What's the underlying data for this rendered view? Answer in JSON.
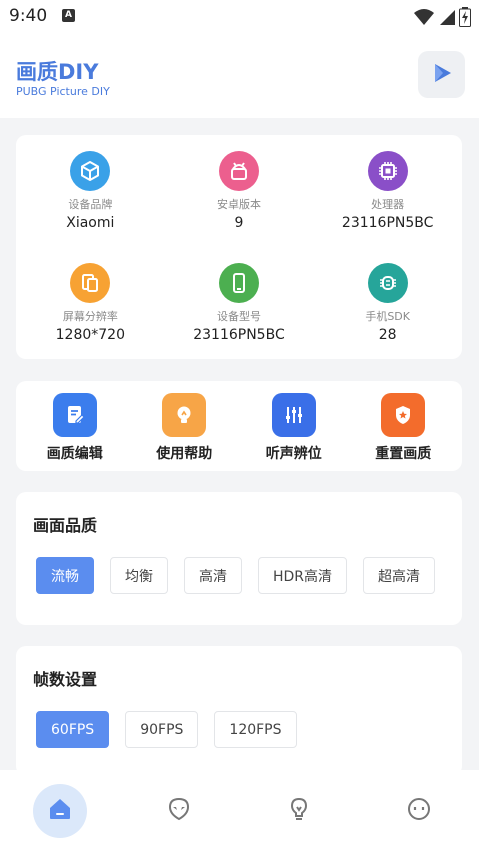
{
  "status": {
    "time": "9:40",
    "badge": "A"
  },
  "header": {
    "title": "画质DIY",
    "subtitle": "PUBG Picture DIY",
    "play_icon": "play-icon"
  },
  "device_info": [
    {
      "label": "设备品牌",
      "value": "Xiaomi",
      "icon": "cube-icon",
      "color": "#3aa1e8"
    },
    {
      "label": "安卓版本",
      "value": "9",
      "icon": "android-icon",
      "color": "#ec5f8e"
    },
    {
      "label": "处理器",
      "value": "23116PN5BC",
      "icon": "cpu-icon",
      "color": "#8a4fc8"
    },
    {
      "label": "屏幕分辨率",
      "value": "1280*720",
      "icon": "screens-icon",
      "color": "#f7a233"
    },
    {
      "label": "设备型号",
      "value": "23116PN5BC",
      "icon": "phone-icon",
      "color": "#4caf50"
    },
    {
      "label": "手机SDK",
      "value": "28",
      "icon": "chip-icon",
      "color": "#26a59a"
    }
  ],
  "actions": [
    {
      "label": "画质编辑",
      "icon": "edit-doc-icon",
      "color": "#3b7ded"
    },
    {
      "label": "使用帮助",
      "icon": "lightbulb-icon",
      "color": "#f7a547"
    },
    {
      "label": "听声辨位",
      "icon": "equalizer-icon",
      "color": "#3a6fe8"
    },
    {
      "label": "重置画质",
      "icon": "shield-icon",
      "color": "#f36c2c"
    }
  ],
  "quality": {
    "title": "画面品质",
    "options": [
      "流畅",
      "均衡",
      "高清",
      "HDR高清",
      "超高清"
    ],
    "selected": "流畅"
  },
  "fps": {
    "title": "帧数设置",
    "options": [
      "60FPS",
      "90FPS",
      "120FPS"
    ],
    "selected": "60FPS"
  },
  "nav": {
    "items": [
      {
        "icon": "home-icon",
        "active": true
      },
      {
        "icon": "alien-icon",
        "active": false
      },
      {
        "icon": "lightbulb-icon",
        "active": false
      },
      {
        "icon": "face-icon",
        "active": false
      }
    ],
    "accent": "#5b8def"
  }
}
